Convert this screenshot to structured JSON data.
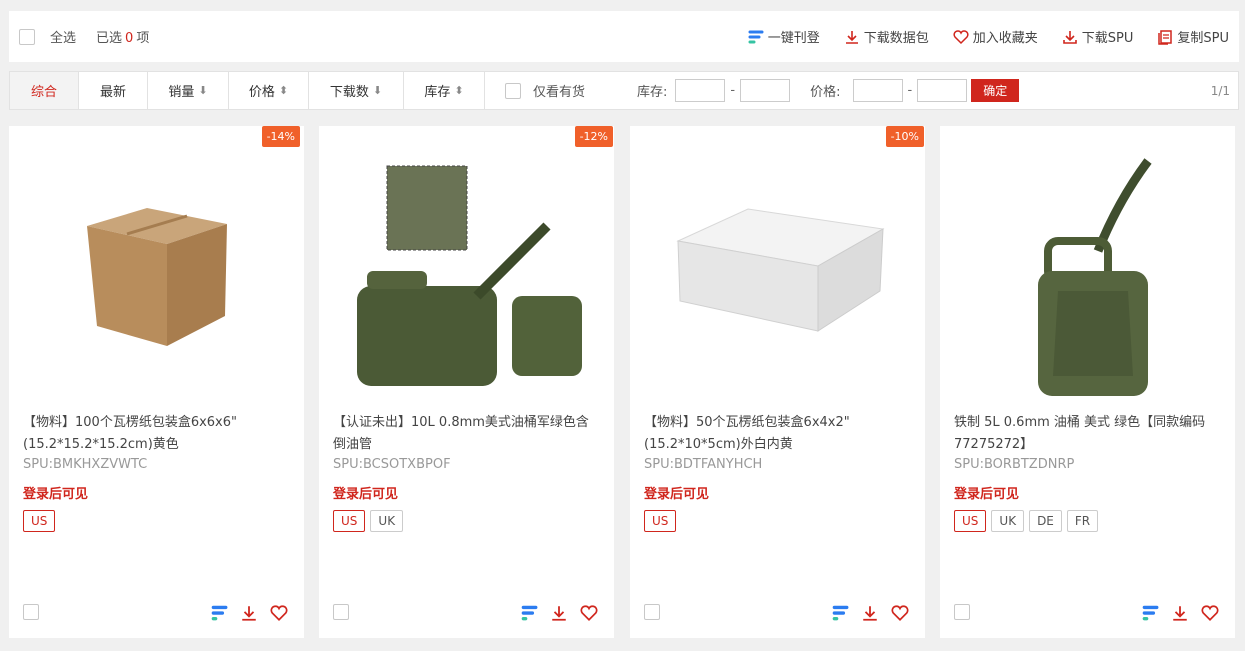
{
  "toolbar": {
    "select_all": "全选",
    "selected_prefix": "已选",
    "selected_count": "0",
    "selected_suffix": "项",
    "actions": [
      {
        "label": "一键刊登",
        "icon": "publish-icon"
      },
      {
        "label": "下载数据包",
        "icon": "download-icon"
      },
      {
        "label": "加入收藏夹",
        "icon": "heart-icon"
      },
      {
        "label": "下载SPU",
        "icon": "download-icon"
      },
      {
        "label": "复制SPU",
        "icon": "copy-icon"
      }
    ]
  },
  "filters": {
    "tabs": [
      {
        "label": "综合",
        "arrow": ""
      },
      {
        "label": "最新",
        "arrow": ""
      },
      {
        "label": "销量",
        "arrow": "⬇"
      },
      {
        "label": "价格",
        "arrow": "⬍"
      },
      {
        "label": "下载数",
        "arrow": "⬇"
      },
      {
        "label": "库存",
        "arrow": "⬍"
      }
    ],
    "only_in_stock": "仅看有货",
    "stock_label": "库存:",
    "price_label": "价格:",
    "confirm": "确定",
    "pager": "1/1"
  },
  "colors": {
    "accent": "#d0261d",
    "badge": "#f0602a",
    "canvas": "#f0f0f0"
  },
  "products": [
    {
      "discount": "-14%",
      "title": "【物料】100个瓦楞纸包装盒6x6x6\"(15.2*15.2*15.2cm)黄色",
      "spu": "SPU:BMKHXZVWTC",
      "price": "登录后可见",
      "tags": [
        "US"
      ],
      "image": "cardboard-box-image"
    },
    {
      "discount": "-12%",
      "title": "【认证未出】10L 0.8mm美式油桶军绿色含倒油管",
      "spu": "SPU:BCSOTXBPOF",
      "price": "登录后可见",
      "tags": [
        "US",
        "UK"
      ],
      "image": "jerry-can-pair-image"
    },
    {
      "discount": "-10%",
      "title": "【物料】50个瓦楞纸包装盒6x4x2\"(15.2*10*5cm)外白内黄",
      "spu": "SPU:BDTFANYHCH",
      "price": "登录后可见",
      "tags": [
        "US"
      ],
      "image": "white-box-image"
    },
    {
      "discount": "",
      "title": "铁制 5L 0.6mm 油桶 美式 绿色【同款编码77275272】",
      "spu": "SPU:BORBTZDNRP",
      "price": "登录后可见",
      "tags": [
        "US",
        "UK",
        "DE",
        "FR"
      ],
      "image": "jerry-can-image"
    }
  ]
}
